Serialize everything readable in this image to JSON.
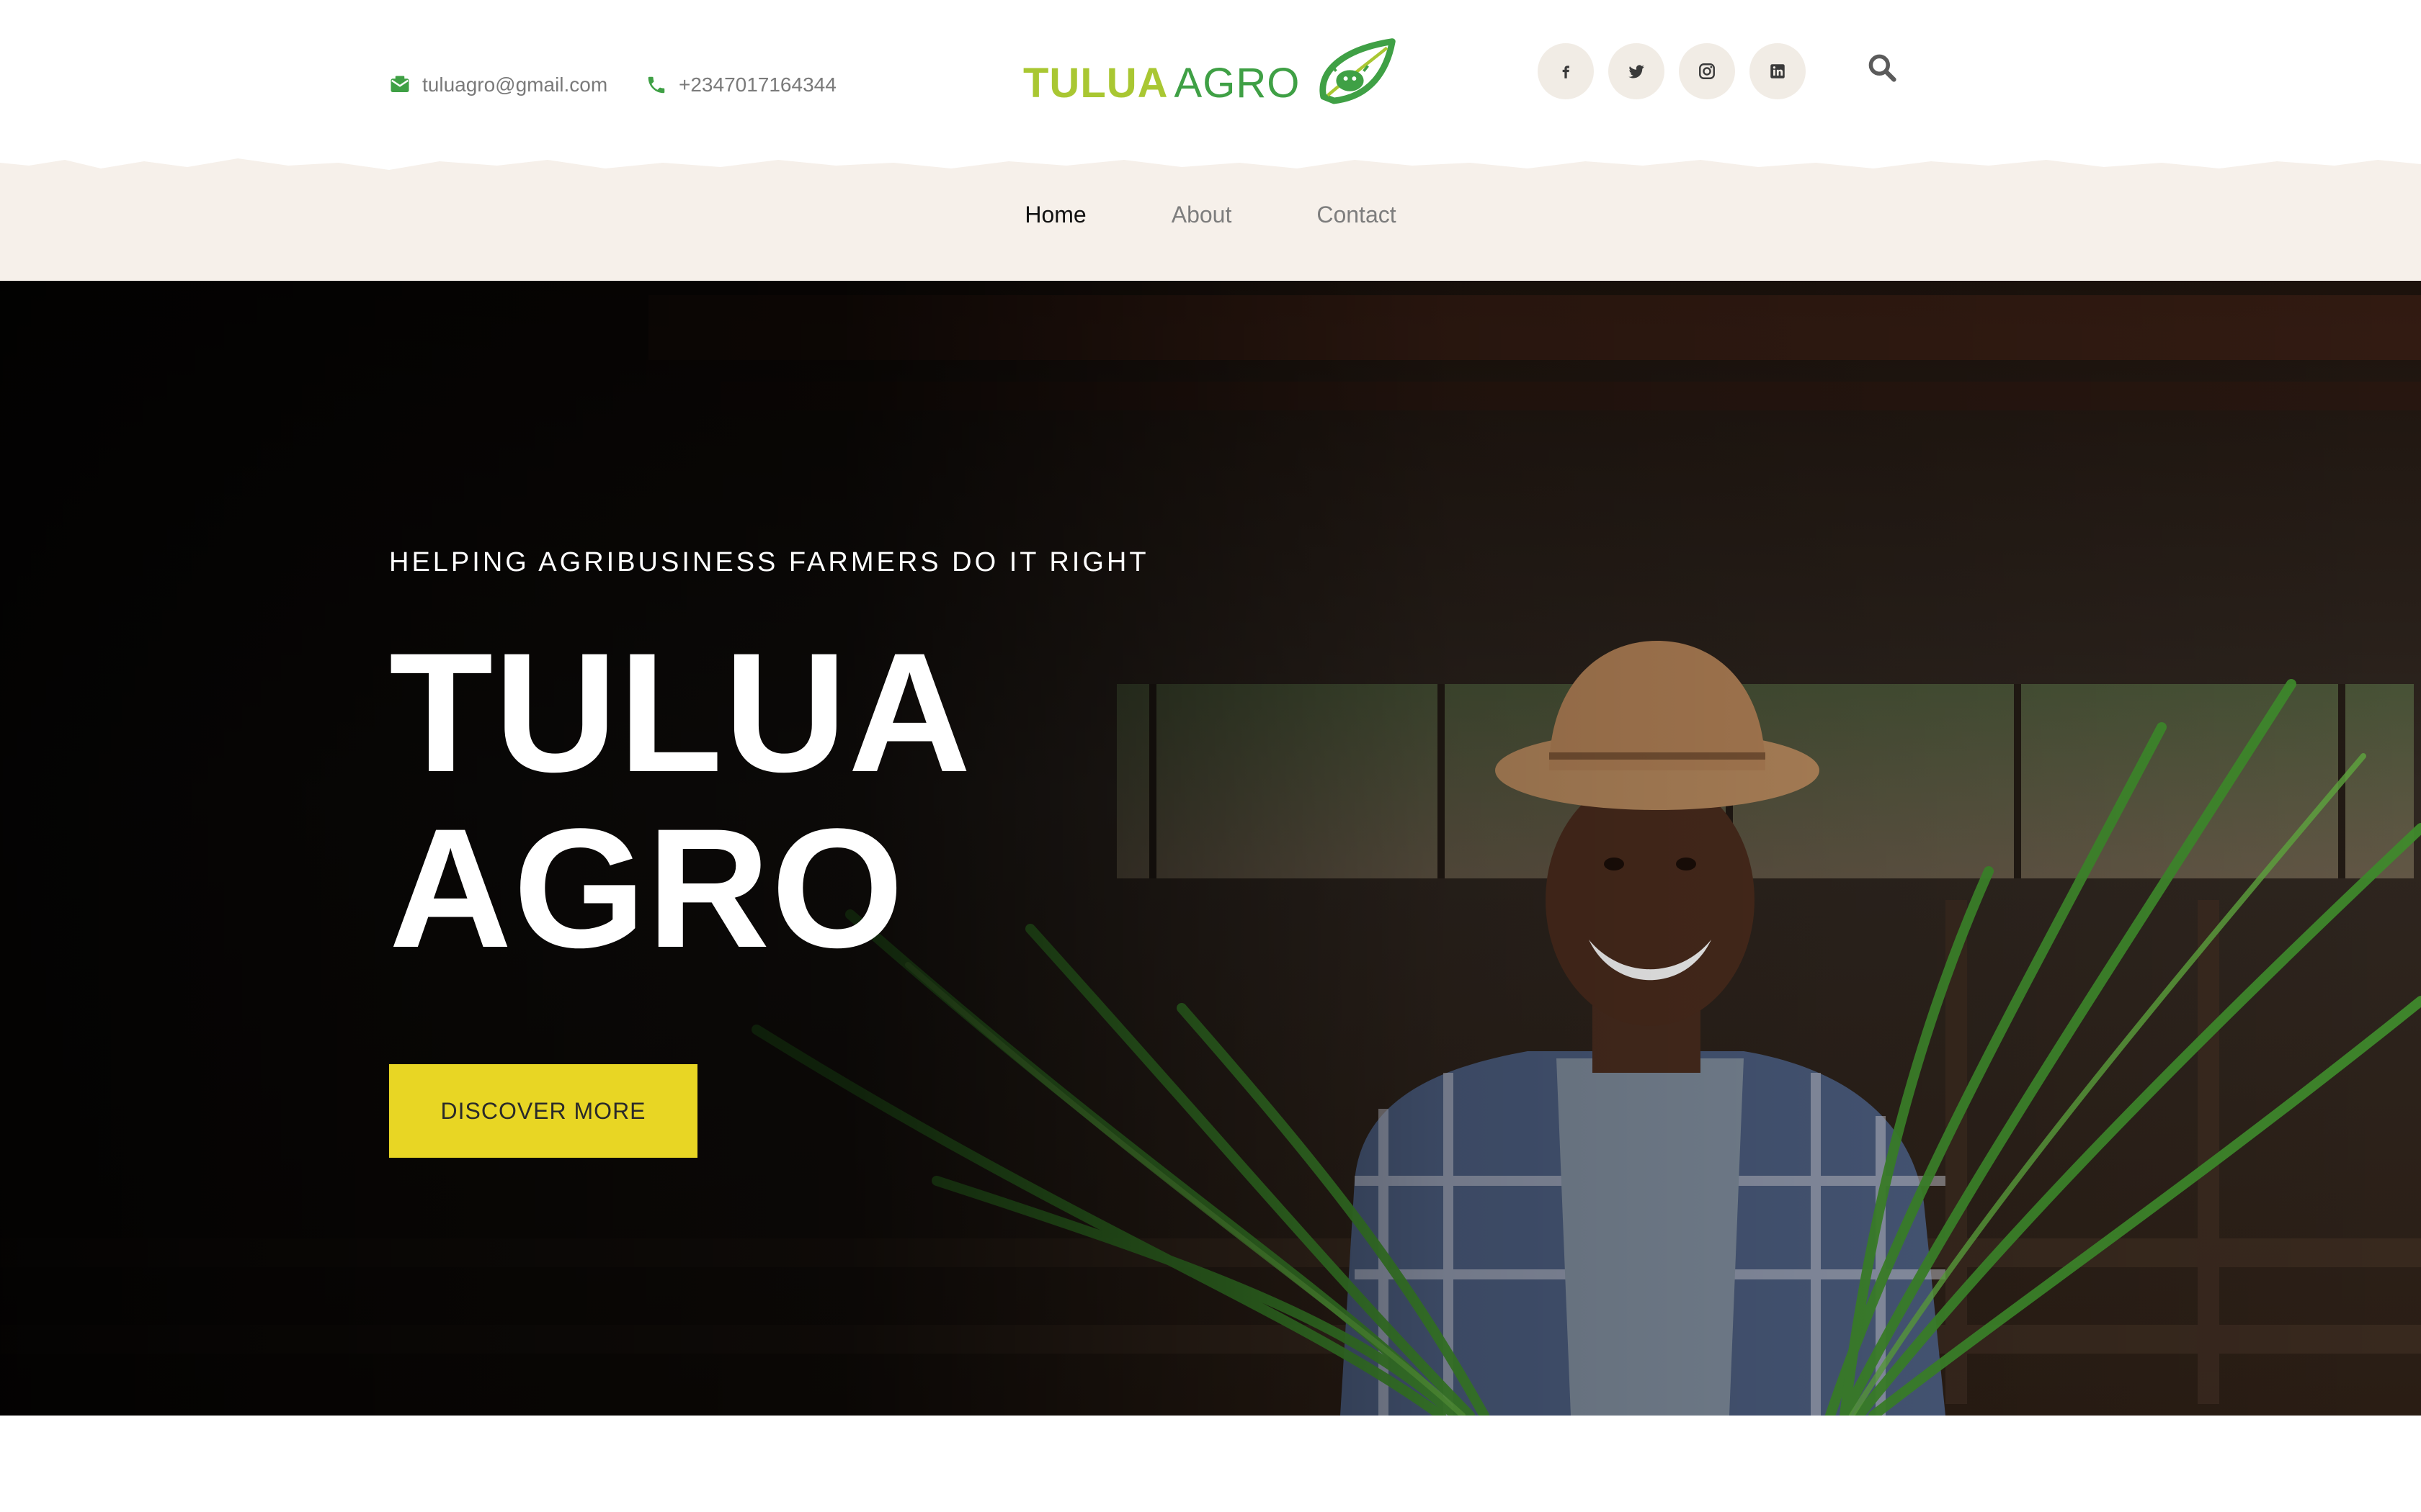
{
  "header": {
    "email": "tuluagro@gmail.com",
    "phone": "+2347017164344",
    "logo": {
      "word1": "TULUA",
      "word2": "AGRO"
    },
    "socials": [
      {
        "icon": "facebook-icon"
      },
      {
        "icon": "twitter-icon"
      },
      {
        "icon": "instagram-icon"
      },
      {
        "icon": "linkedin-icon"
      }
    ],
    "search_icon": "search-icon"
  },
  "nav": {
    "items": [
      {
        "label": "Home",
        "active": true
      },
      {
        "label": "About",
        "active": false
      },
      {
        "label": "Contact",
        "active": false
      }
    ]
  },
  "hero": {
    "kicker": "HELPING AGRIBUSINESS FARMERS DO IT RIGHT",
    "title_line1": "TULUA",
    "title_line2": "AGRO",
    "cta_label": "DISCOVER MORE"
  },
  "colors": {
    "accent_green": "#3fa045",
    "logo_lime": "#a9c732",
    "cta_yellow": "#e8d624",
    "nav_bg": "#f6f0ea"
  }
}
